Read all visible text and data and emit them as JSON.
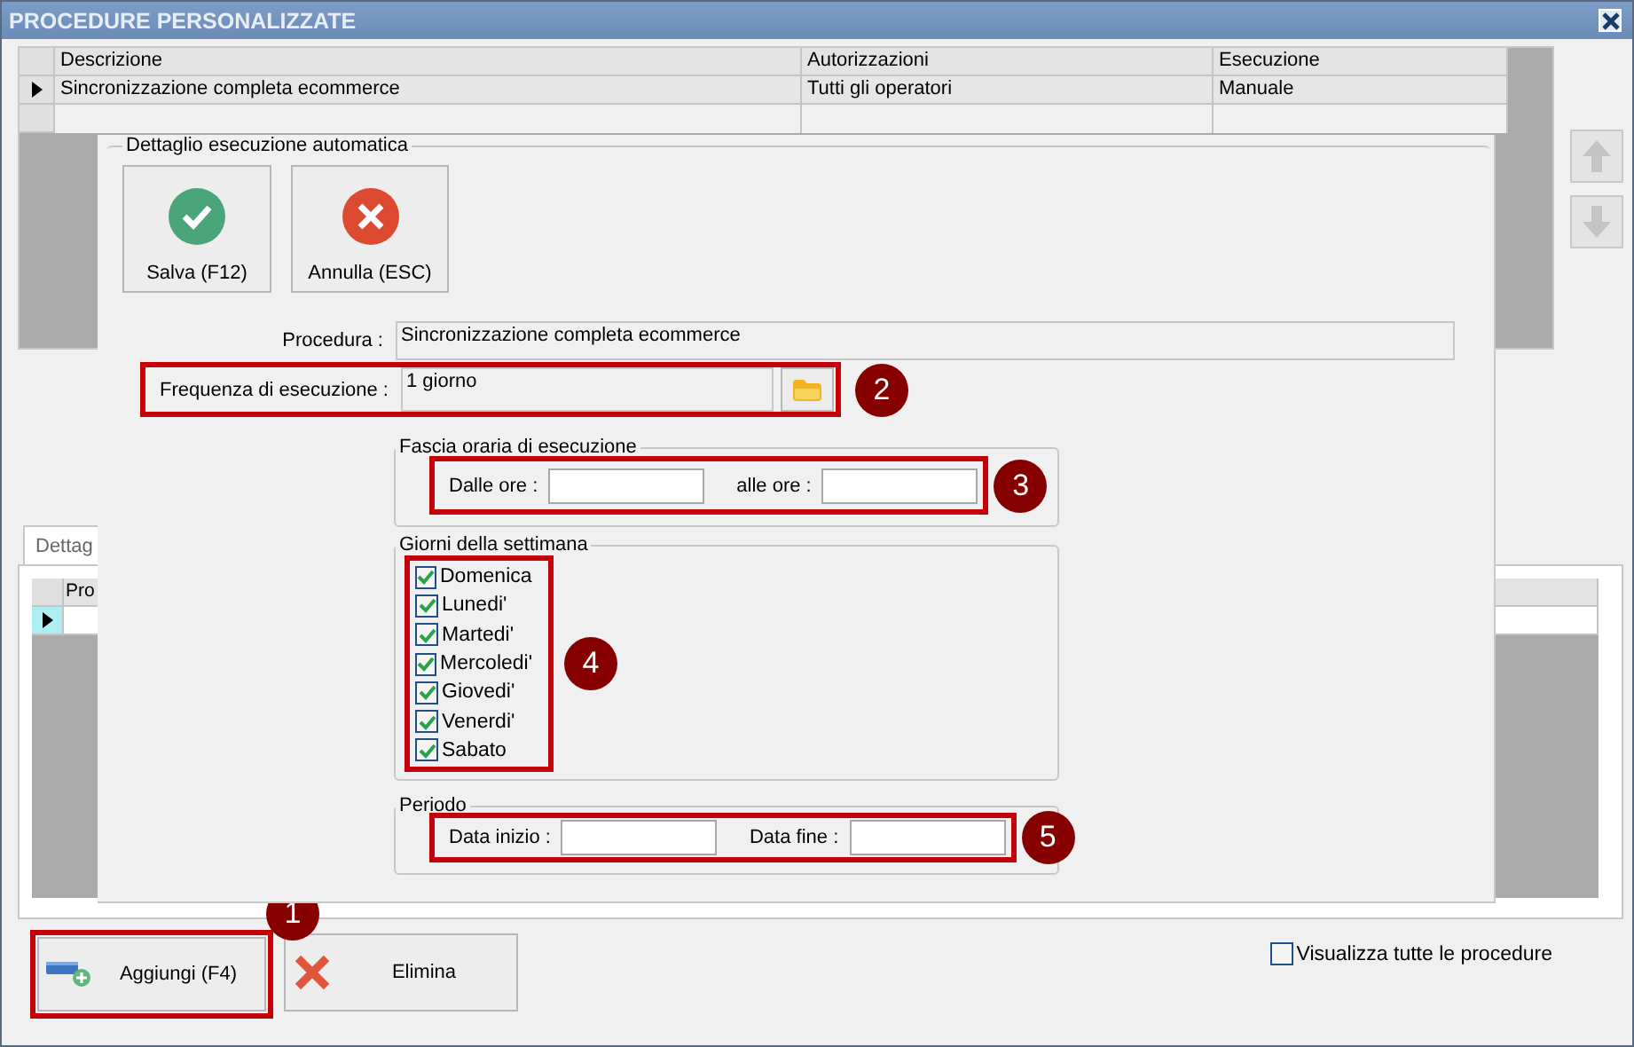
{
  "window": {
    "title": "PROCEDURE PERSONALIZZATE"
  },
  "procedures_table": {
    "columns": [
      "Descrizione",
      "Autorizzazioni",
      "Esecuzione"
    ],
    "rows": [
      {
        "cells": [
          "Sincronizzazione completa ecommerce",
          "Tutti gli operatori",
          "Manuale"
        ],
        "selected": true
      }
    ]
  },
  "detail_tab": {
    "label": "Dettag"
  },
  "detail_table": {
    "columns": [
      "Pro"
    ],
    "rows": [
      {
        "selected": true
      }
    ]
  },
  "dialog": {
    "title": "Dettaglio esecuzione automatica",
    "buttons": [
      {
        "label": "Salva (F12)",
        "kind": "confirm"
      },
      {
        "label": "Annulla (ESC)",
        "kind": "cancel"
      }
    ],
    "procedure": {
      "label": "Procedura :",
      "value": "Sincronizzazione completa ecommerce"
    },
    "frequency": {
      "label": "Frequenza di esecuzione :",
      "value": "1 giorno",
      "callout": "2"
    },
    "time_range": {
      "title": "Fascia oraria di esecuzione",
      "from_label": "Dalle ore :",
      "to_label": "alle ore :",
      "callout": "3"
    },
    "weekdays": {
      "title": "Giorni della settimana",
      "callout": "4",
      "days": [
        {
          "label": "Domenica",
          "checked": true
        },
        {
          "label": "Lunedi'",
          "checked": true
        },
        {
          "label": "Martedi'",
          "checked": true
        },
        {
          "label": "Mercoledi'",
          "checked": true
        },
        {
          "label": "Giovedi'",
          "checked": true
        },
        {
          "label": "Venerdi'",
          "checked": true
        },
        {
          "label": "Sabato",
          "checked": true
        }
      ]
    },
    "period": {
      "title": "Periodo",
      "start_label": "Data inizio :",
      "end_label": "Data fine :",
      "callout": "5"
    }
  },
  "actions": {
    "add": {
      "label": "Aggiungi (F4)",
      "callout": "1"
    },
    "delete": {
      "label": "Elimina"
    },
    "show_all": {
      "label": "Visualizza tutte le procedure",
      "checked": false
    }
  }
}
